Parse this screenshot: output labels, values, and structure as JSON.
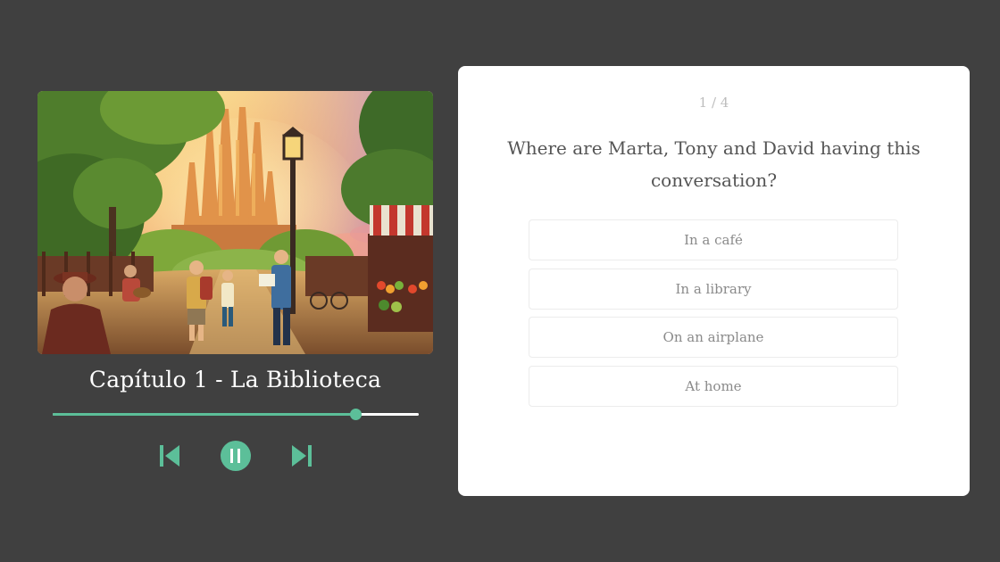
{
  "player": {
    "chapter_title": "Capítulo 1 - La Biblioteca",
    "progress_fraction": 0.828,
    "controls": {
      "prev_icon": "skip-previous-icon",
      "play_pause_icon": "pause-icon",
      "next_icon": "skip-next-icon"
    },
    "cover_image": "illustrated park scene with cathedral, lamp post, market stall and travelers"
  },
  "quiz": {
    "counter": "1 / 4",
    "question": "Where are Marta, Tony and David having this conversation?",
    "answers": [
      "In a café",
      "In a library",
      "On an airplane",
      "At home"
    ]
  },
  "colors": {
    "background": "#404040",
    "accent": "#5cbf99",
    "card": "#ffffff"
  }
}
